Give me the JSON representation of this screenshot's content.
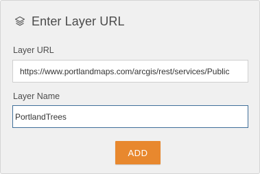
{
  "dialog": {
    "title": "Enter Layer URL",
    "icon": "layers-icon"
  },
  "url_field": {
    "label": "Layer URL",
    "value": "https://www.portlandmaps.com/arcgis/rest/services/Public"
  },
  "name_field": {
    "label": "Layer Name",
    "value": "PortlandTrees"
  },
  "add_button": {
    "label": "ADD"
  },
  "colors": {
    "panel_bg": "#f0f0f0",
    "accent": "#e8882e",
    "focus_border": "#3f6f99"
  }
}
